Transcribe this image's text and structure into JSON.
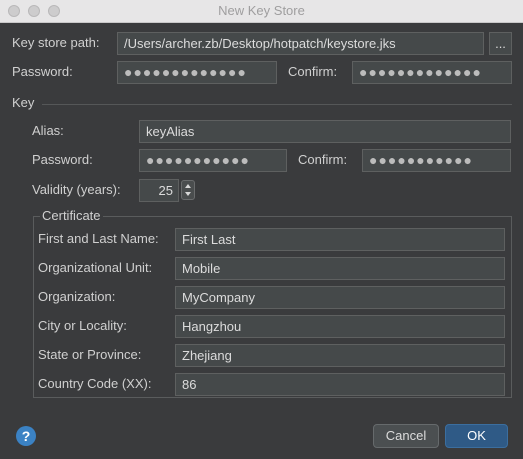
{
  "window": {
    "title": "New Key Store"
  },
  "keystore": {
    "path_label": "Key store path:",
    "path_value": "/Users/archer.zb/Desktop/hotpatch/keystore.jks",
    "browse_label": "...",
    "password_label": "Password:",
    "password_value": "●●●●●●●●●●●●●",
    "confirm_label": "Confirm:",
    "confirm_value": "●●●●●●●●●●●●●"
  },
  "key": {
    "section_label": "Key",
    "alias_label": "Alias:",
    "alias_value": "keyAlias",
    "password_label": "Password:",
    "password_value": "●●●●●●●●●●●",
    "confirm_label": "Confirm:",
    "confirm_value": "●●●●●●●●●●●",
    "validity_label": "Validity (years):",
    "validity_value": "25"
  },
  "certificate": {
    "section_label": "Certificate",
    "fields": [
      {
        "label": "First and Last Name:",
        "value": "First Last"
      },
      {
        "label": "Organizational Unit:",
        "value": "Mobile"
      },
      {
        "label": "Organization:",
        "value": "MyCompany"
      },
      {
        "label": "City or Locality:",
        "value": "Hangzhou"
      },
      {
        "label": "State or Province:",
        "value": "Zhejiang"
      },
      {
        "label": "Country Code (XX):",
        "value": "86"
      }
    ]
  },
  "footer": {
    "help_label": "?",
    "cancel_label": "Cancel",
    "ok_label": "OK"
  },
  "colors": {
    "accent": "#3b82c4",
    "ok_button": "#2f5a86"
  }
}
